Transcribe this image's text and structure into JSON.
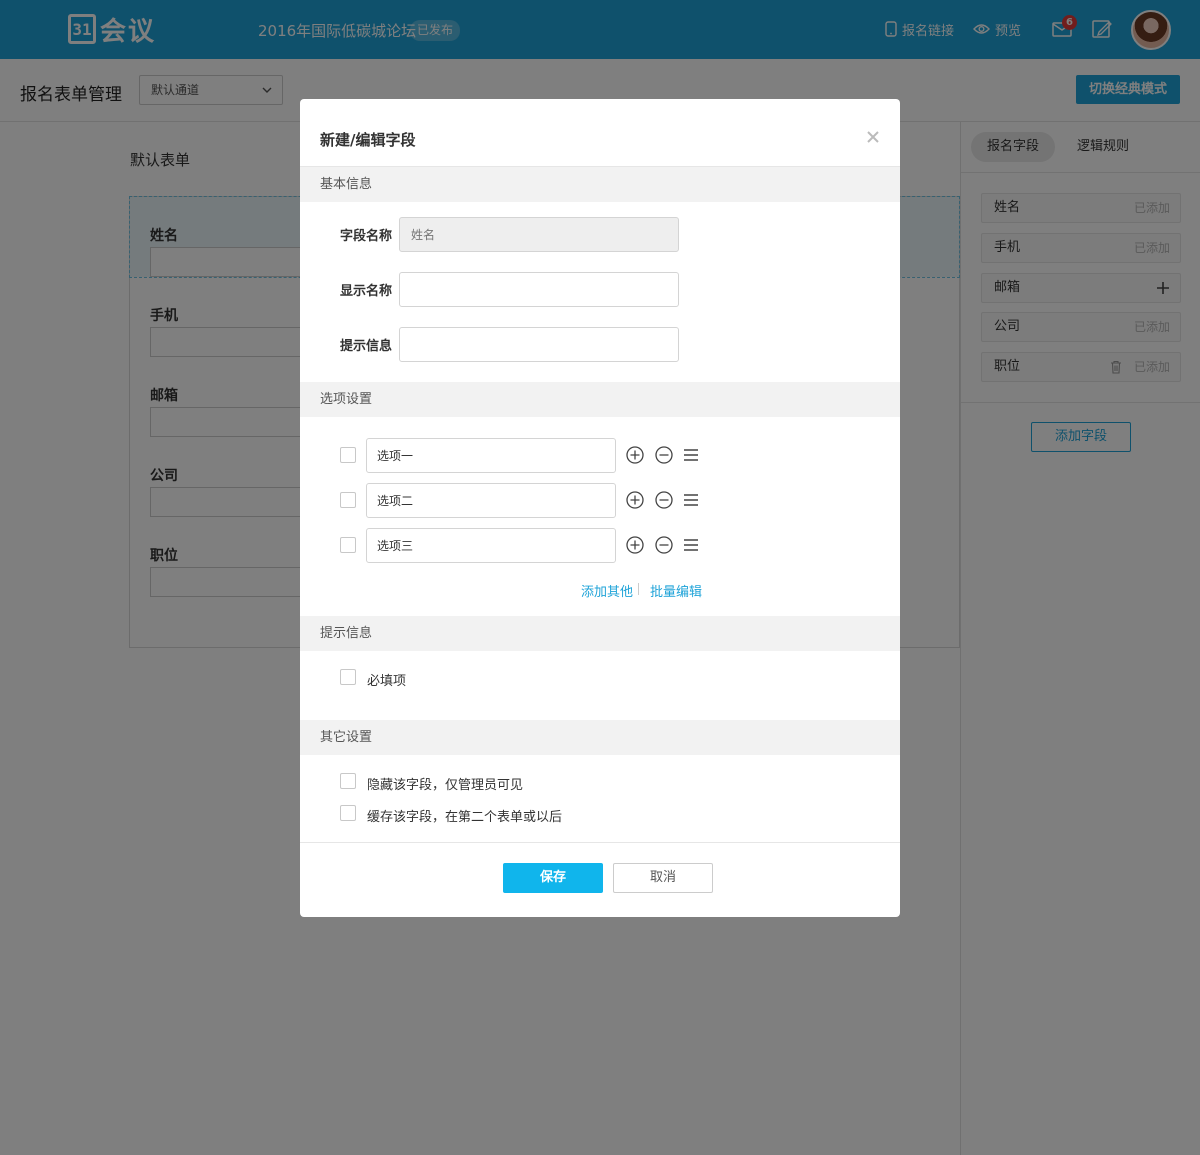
{
  "header": {
    "logo_mark": "31",
    "logo_text": "会议",
    "event_title": "2016年国际低碳城论坛",
    "status_badge": "已发布",
    "signup_link_label": "报名链接",
    "preview_label": "预览",
    "mail_badge_count": "6"
  },
  "subheader": {
    "title": "报名表单管理",
    "channel_select": "默认通道",
    "switch_button": "切换经典模式"
  },
  "form_preview": {
    "heading": "默认表单",
    "fields": [
      {
        "label": "姓名"
      },
      {
        "label": "手机"
      },
      {
        "label": "邮箱"
      },
      {
        "label": "公司"
      },
      {
        "label": "职位"
      }
    ]
  },
  "right_panel": {
    "tabs": [
      {
        "label": "报名字段"
      },
      {
        "label": "逻辑规则"
      }
    ],
    "fields": [
      {
        "label": "姓名",
        "state": "已添加"
      },
      {
        "label": "手机",
        "state": "已添加"
      },
      {
        "label": "邮箱",
        "state": ""
      },
      {
        "label": "公司",
        "state": "已添加"
      },
      {
        "label": "职位",
        "state": "已添加"
      }
    ],
    "add_field_button": "添加字段"
  },
  "modal": {
    "title": "新建/编辑字段",
    "sections": {
      "basic": "基本信息",
      "options": "选项设置",
      "hint": "提示信息",
      "other": "其它设置"
    },
    "basic": {
      "field_name_label": "字段名称",
      "field_name_placeholder": "姓名",
      "display_name_label": "显示名称",
      "display_name_value": "",
      "hint_label": "提示信息",
      "hint_value": ""
    },
    "options": [
      {
        "value": "选项一"
      },
      {
        "value": "选项二"
      },
      {
        "value": "选项三"
      }
    ],
    "add_other_link": "添加其他",
    "batch_edit_link": "批量编辑",
    "required_label": "必填项",
    "hide_field_label": "隐藏该字段，仅管理员可见",
    "cache_field_label": "缓存该字段，在第二个表单或以后",
    "save_button": "保存",
    "cancel_button": "取消"
  },
  "colors": {
    "brand": "#1fa3d8",
    "primary_button": "#10b5ec",
    "badge": "#e23b3b"
  }
}
